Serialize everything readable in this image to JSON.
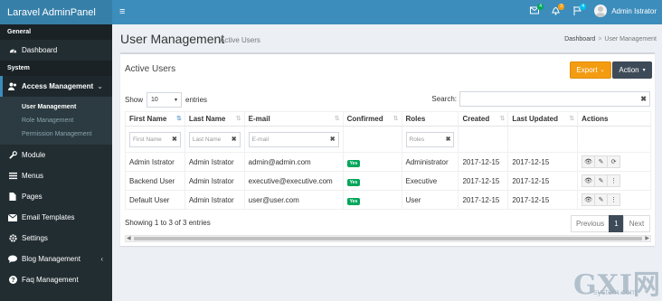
{
  "brand": "Laravel AdminPanel",
  "sidebar": {
    "section_general": "General",
    "dashboard": "Dashboard",
    "section_system": "System",
    "access_management": "Access Management",
    "sub_items": [
      "User Management",
      "Role Management",
      "Permission Management"
    ],
    "items": [
      "Module",
      "Menus",
      "Pages",
      "Email Templates",
      "Settings",
      "Blog Management",
      "Faq Management"
    ]
  },
  "header": {
    "badges": [
      "4",
      "3",
      "4"
    ],
    "user_name": "Admin Istrator"
  },
  "page": {
    "title": "User Management",
    "subtitle": "Active Users",
    "breadcrumb": [
      "Dashboard",
      "User Management"
    ]
  },
  "box": {
    "title": "Active Users",
    "export_label": "Export",
    "action_label": "Action",
    "show_label": "Show",
    "show_value": "10",
    "entries_label": "entries",
    "search_label": "Search:"
  },
  "table": {
    "headers": [
      "First Name",
      "Last Name",
      "E-mail",
      "Confirmed",
      "Roles",
      "Created",
      "Last Updated",
      "Actions"
    ],
    "filters": {
      "first": "First Name",
      "last": "Last Name",
      "email": "E-mail",
      "roles": "Roles"
    },
    "rows": [
      {
        "first": "Admin Istrator",
        "last": "Admin Istrator",
        "email": "admin@admin.com",
        "confirmed": "Yes",
        "role": "Administrator",
        "created": "2017-12-15",
        "updated": "2017-12-15"
      },
      {
        "first": "Backend User",
        "last": "Admin Istrator",
        "email": "executive@executive.com",
        "confirmed": "Yes",
        "role": "Executive",
        "created": "2017-12-15",
        "updated": "2017-12-15"
      },
      {
        "first": "Default User",
        "last": "Admin Istrator",
        "email": "user@user.com",
        "confirmed": "Yes",
        "role": "User",
        "created": "2017-12-15",
        "updated": "2017-12-15"
      }
    ]
  },
  "footer": {
    "info": "Showing 1 to 3 of 3 entries",
    "prev": "Previous",
    "page": "1",
    "next": "Next"
  },
  "watermark": {
    "main": "GXI网",
    "sub": "system.com"
  },
  "colors": {
    "sidebar": "#222d32",
    "header": "#3c8dbc",
    "export": "#f39c12",
    "action": "#3d4a57",
    "success": "#00a65a"
  }
}
